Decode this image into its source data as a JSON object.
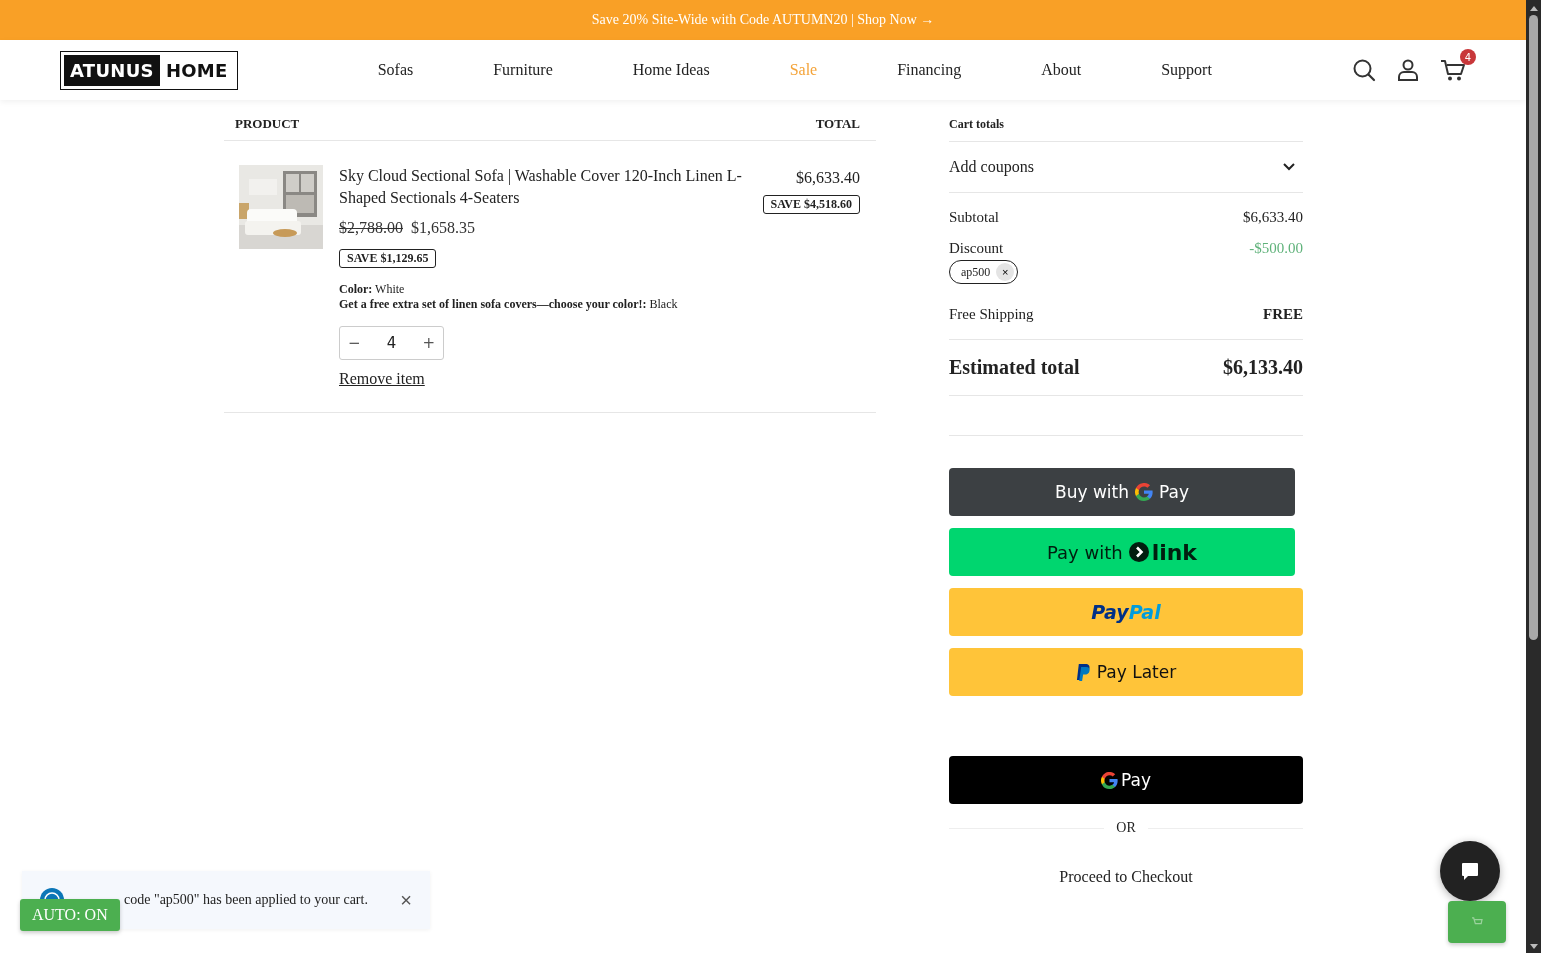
{
  "banner": {
    "text": "Save 20% Site-Wide with Code AUTUMN20 | Shop Now →"
  },
  "header": {
    "logo": [
      "ATUNUS",
      "HOME"
    ],
    "nav": [
      {
        "label": "Sofas",
        "selected": false
      },
      {
        "label": "Furniture",
        "selected": false
      },
      {
        "label": "Home Ideas",
        "selected": false
      },
      {
        "label": "Sale",
        "selected": true
      },
      {
        "label": "Financing",
        "selected": false
      },
      {
        "label": "About",
        "selected": false
      },
      {
        "label": "Support",
        "selected": false
      }
    ],
    "cart_count": "4"
  },
  "cart": {
    "columns": [
      "PRODUCT",
      "TOTAL"
    ],
    "items": [
      {
        "name": "Sky Cloud Sectional Sofa | Washable Cover 120-Inch Linen L-Shaped Sectionals 4-Seaters",
        "old_price": "$2,788.00",
        "price": "$1,658.35",
        "save": "SAVE $1,129.65",
        "options": [
          "**Color:** White",
          "**Get a free extra set of linen sofa covers—choose your color!:** Black"
        ],
        "quantity": "4",
        "minus": "−",
        "plus": "+",
        "remove": "Remove item",
        "total": "$6,633.40",
        "total_save": "SAVE $4,518.60"
      }
    ]
  },
  "totals": {
    "title": "Cart totals",
    "coupons": {
      "label": "Add coupons",
      "expanded": false
    },
    "subtotal": {
      "label": "Subtotal",
      "value": "$6,633.40"
    },
    "discount": {
      "label": "Discount",
      "value": "-$500.00",
      "coupon": "ap500",
      "remove": "×"
    },
    "shipping": {
      "label": "Free Shipping",
      "value": "FREE"
    },
    "estimated": {
      "label": "Estimated total",
      "value": "$6,133.40"
    }
  },
  "payments": [
    {
      "kind": "gpay-buy",
      "pre": "Buy with",
      "brand": "Pay"
    },
    {
      "kind": "link",
      "pre": "Pay with",
      "brand": "link"
    },
    {
      "kind": "paypal",
      "pre": "Pay",
      "brand": "Pal"
    },
    {
      "kind": "paylater",
      "brand": "Pay Later"
    },
    {
      "kind": "gpay",
      "brand": "Pay"
    }
  ],
  "separator": "OR",
  "checkout": "Proceed to Checkout",
  "toast": {
    "text": "code \"ap500\" has been applied to your cart.",
    "close": "×"
  },
  "auto_badge": "AUTO: ON"
}
